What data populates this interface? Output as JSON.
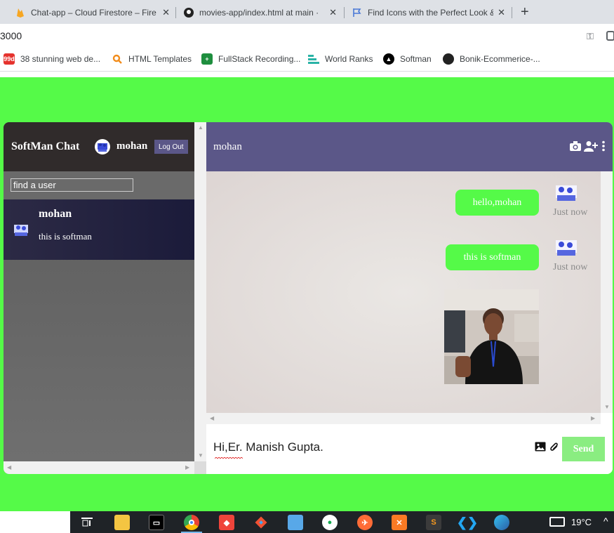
{
  "browser": {
    "tabs": [
      {
        "title": "Chat-app – Cloud Firestore – Fire",
        "icon": "firebase-icon",
        "active": false
      },
      {
        "title": "movies-app/index.html at main ·",
        "icon": "github-icon",
        "active": false
      },
      {
        "title": "Find Icons with the Perfect Look &",
        "icon": "flag-icon",
        "active": true
      }
    ],
    "url": "3000",
    "bookmarks": [
      {
        "label": "38 stunning web de...",
        "icon": "99d-icon",
        "color": "#e5322d"
      },
      {
        "label": "HTML Templates",
        "icon": "search-icon",
        "color": "#f28c1b"
      },
      {
        "label": "FullStack Recording...",
        "icon": "sheet-icon",
        "color": "#1e8e3e"
      },
      {
        "label": "World Ranks",
        "icon": "bars-icon",
        "color": "#2ab3a6"
      },
      {
        "label": "Softman",
        "icon": "softman-icon",
        "color": "#000000"
      },
      {
        "label": "Bonik-Ecommerice-...",
        "icon": "github-icon",
        "color": "#000000"
      }
    ]
  },
  "app": {
    "brand": "SoftMan Chat",
    "current_user": "mohan",
    "logout_label": "Log Out",
    "search_placeholder": "find a user",
    "chat_list": [
      {
        "name": "mohan",
        "last_message": "this is softman"
      }
    ],
    "chat": {
      "contact_name": "mohan",
      "messages": [
        {
          "text": "hello,mohan",
          "time": "Just now"
        },
        {
          "text": "this is softman",
          "time": "Just now"
        },
        {
          "image": "photo of a man in black t-shirt",
          "time": ""
        }
      ],
      "composer_value": "Hi,Er. Manish Gupta.",
      "send_label": "Send"
    },
    "colors": {
      "page_bg": "#55fa48",
      "header_purple": "#5b5788",
      "bubble_green": "#55fa48",
      "sidebar_dark": "#302b2b"
    }
  },
  "taskbar": {
    "temperature": "19°C"
  }
}
